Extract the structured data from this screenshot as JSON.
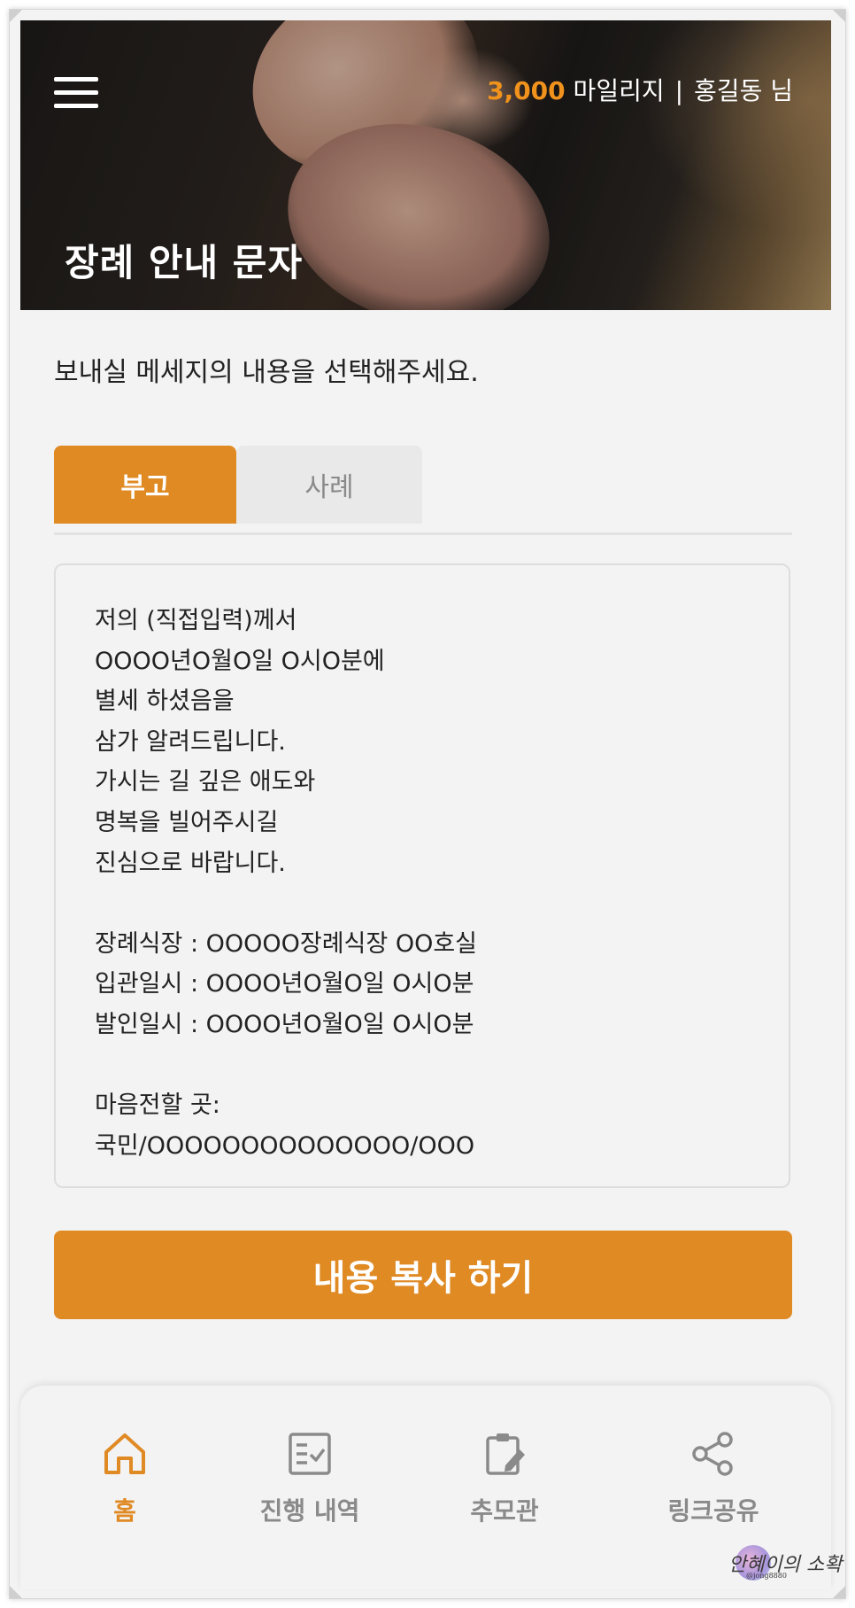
{
  "header": {
    "mileage_value": "3,000",
    "mileage_label": " 마일리지",
    "separator": "|",
    "user": "홍길동 님",
    "title": "장례 안내 문자"
  },
  "instruction": "보내실 메세지의 내용을 선택해주세요.",
  "tabs": [
    {
      "label": "부고",
      "active": true
    },
    {
      "label": "사례",
      "active": false
    }
  ],
  "message": {
    "lines": [
      "저의 (직접입력)께서",
      "OOOO년O월O일 O시O분에",
      "별세 하셨음을",
      "삼가 알려드립니다.",
      "가시는 길 깊은 애도와",
      "명복을 빌어주시길",
      "진심으로 바랍니다.",
      "",
      "장례식장 : OOOOO장례식장 OO호실",
      "입관일시 : OOOO년O월O일 O시O분",
      "발인일시 : OOOO년O월O일 O시O분",
      "",
      "마음전할 곳:",
      "국민/OOOOOOOOOOOOOO/OOO"
    ]
  },
  "copy_button": "내용 복사 하기",
  "bottom_nav": [
    {
      "label": "홈",
      "icon": "home-icon",
      "active": true
    },
    {
      "label": "진행 내역",
      "icon": "checklist-icon",
      "active": false
    },
    {
      "label": "추모관",
      "icon": "clipboard-edit-icon",
      "active": false
    },
    {
      "label": "링크공유",
      "icon": "share-icon",
      "active": false
    }
  ],
  "colors": {
    "accent": "#e08a24",
    "mileage": "#f0921c"
  },
  "watermark": {
    "text": "안혜이의 소확행",
    "sub": "@jong8880"
  }
}
